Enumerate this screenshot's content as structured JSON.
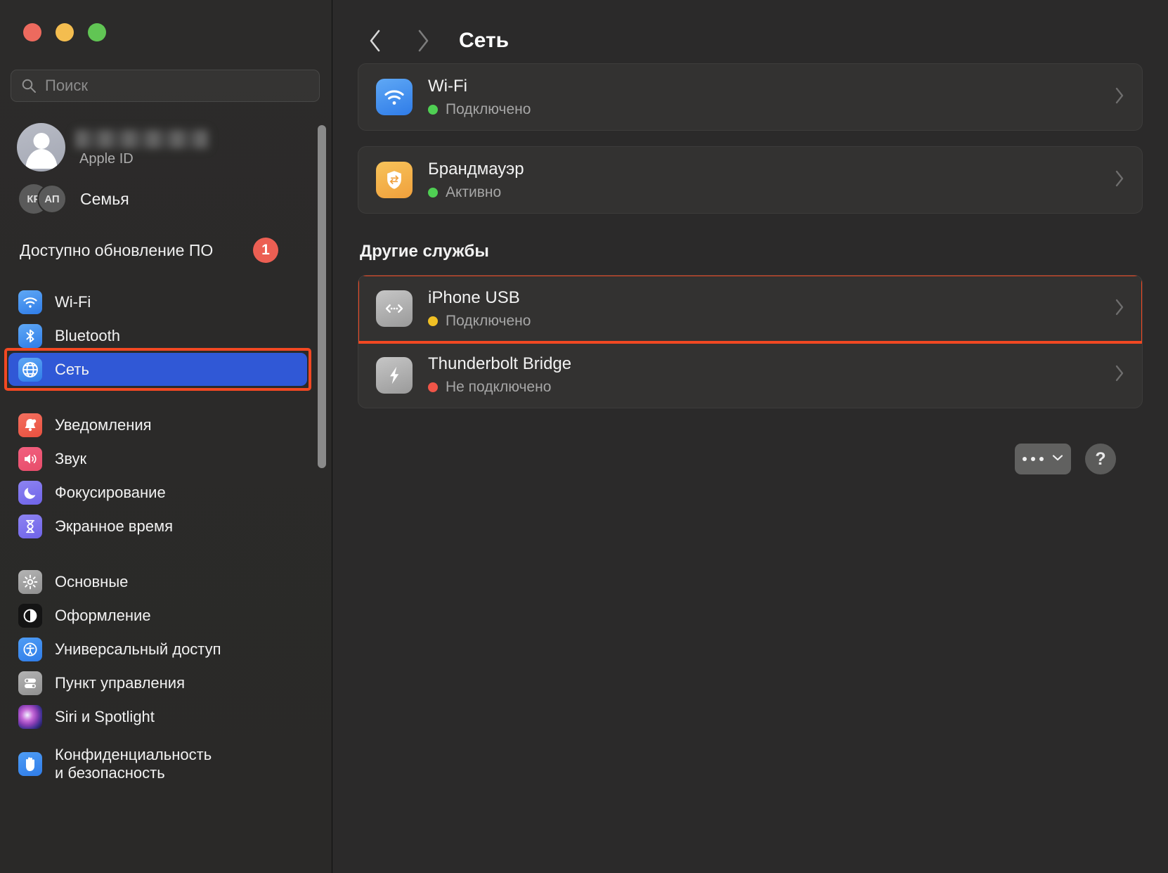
{
  "window": {
    "traffic_lights": [
      "close",
      "minimize",
      "zoom"
    ],
    "colors": {
      "close": "#ed6a5e",
      "minimize": "#f4bd4f",
      "zoom": "#61c554",
      "selection": "#3058d6",
      "highlight": "#f24822",
      "green_status": "#4fcf53",
      "yellow_status": "#f0c024",
      "red_status": "#f05548",
      "badge": "#ec5f53"
    }
  },
  "sidebar": {
    "search": {
      "placeholder": "Поиск",
      "value": ""
    },
    "account": {
      "name": "",
      "subtitle": "Apple ID"
    },
    "family": {
      "label": "Семья",
      "avatars": [
        "КР",
        "АП"
      ]
    },
    "update": {
      "label": "Доступно обновление ПО",
      "badge": "1"
    },
    "groups": [
      {
        "items": [
          {
            "label": "Wi-Fi",
            "icon": "wifi-icon",
            "selected": false
          },
          {
            "label": "Bluetooth",
            "icon": "bluetooth-icon",
            "selected": false
          },
          {
            "label": "Сеть",
            "icon": "globe-icon",
            "selected": true
          }
        ]
      },
      {
        "items": [
          {
            "label": "Уведомления",
            "icon": "bell-icon",
            "selected": false
          },
          {
            "label": "Звук",
            "icon": "speaker-icon",
            "selected": false
          },
          {
            "label": "Фокусирование",
            "icon": "moon-icon",
            "selected": false
          },
          {
            "label": "Экранное время",
            "icon": "hourglass-icon",
            "selected": false
          }
        ]
      },
      {
        "items": [
          {
            "label": "Основные",
            "icon": "gear-icon",
            "selected": false
          },
          {
            "label": "Оформление",
            "icon": "appearance-icon",
            "selected": false
          },
          {
            "label": "Универсальный доступ",
            "icon": "accessibility-icon",
            "selected": false
          },
          {
            "label": "Пункт управления",
            "icon": "sliders-icon",
            "selected": false
          },
          {
            "label": "Siri и Spotlight",
            "icon": "siri-icon",
            "selected": false
          },
          {
            "label": "Конфиденциальность\nи безопасность",
            "icon": "hand-icon",
            "selected": false
          }
        ]
      }
    ]
  },
  "main": {
    "back_icon": "chevron-left-icon",
    "forward_icon": "chevron-right-icon",
    "title": "Сеть",
    "primary_services": [
      {
        "name": "Wi-Fi",
        "icon": "wifi-icon",
        "status": "Подключено",
        "status_color": "#4fcf53",
        "chevron": "chevron-right-icon"
      },
      {
        "name": "Брандмауэр",
        "icon": "firewall-icon",
        "status": "Активно",
        "status_color": "#4fcf53",
        "chevron": "chevron-right-icon"
      }
    ],
    "other_section_title": "Другие службы",
    "other_services": [
      {
        "name": "iPhone USB",
        "icon": "usb-bridge-icon",
        "status": "Подключено",
        "status_color": "#f0c024",
        "chevron": "chevron-right-icon",
        "highlighted": true
      },
      {
        "name": "Thunderbolt Bridge",
        "icon": "thunderbolt-icon",
        "status": "Не подключено",
        "status_color": "#f05548",
        "chevron": "chevron-right-icon",
        "highlighted": false
      }
    ],
    "footer": {
      "more_label": "•••",
      "more_icon": "chevron-down-icon",
      "help_label": "?"
    }
  }
}
